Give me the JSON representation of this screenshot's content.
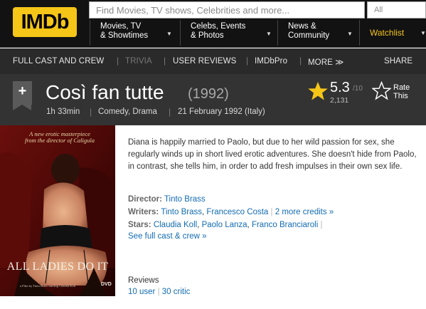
{
  "navbar": {
    "logo": "IMDb",
    "search_placeholder": "Find Movies, TV shows, Celebrities and more...",
    "search_category": "All",
    "menus": [
      {
        "label": "Movies, TV\n& Showtimes"
      },
      {
        "label": "Celebs, Events\n& Photos"
      },
      {
        "label": "News &\nCommunity"
      }
    ],
    "watchlist": "Watchlist",
    "colors": {
      "brand": "#f5c518",
      "background": "#121212"
    }
  },
  "subnav": {
    "items": [
      {
        "label": "FULL CAST AND CREW"
      },
      {
        "label": "TRIVIA"
      },
      {
        "label": "USER REVIEWS"
      },
      {
        "label": "IMDbPro"
      },
      {
        "label": "MORE ≫"
      }
    ],
    "share": "SHARE"
  },
  "title": {
    "add_symbol": "+",
    "name": "Così fan tutte",
    "year": "(1992)",
    "runtime": "1h 33min",
    "genres": "Comedy, Drama",
    "release": "21 February 1992 (Italy)",
    "rating": "5.3",
    "rating_max": "/10",
    "rating_count": "2,131",
    "rate_label": "Rate\nThis"
  },
  "poster": {
    "tagline": "A new erotic masterpiece\nfrom the director of Caligula",
    "title": "ALL LADIES DO IT",
    "credit": "a Film by Tinto Brass    starring Claudia Koll",
    "badge": "DVD"
  },
  "main": {
    "summary": "Diana is happily married to Paolo, but due to her wild passion for sex, she regularly winds up in short lived erotic adventures. She doesn't hide from Paolo, in contrast, she tells him, in order to add fresh impulses in their own sex life.",
    "director_label": "Director:",
    "director": "Tinto Brass",
    "writers_label": "Writers:",
    "writers": [
      "Tinto Brass",
      "Francesco Costa"
    ],
    "more_credits": "2 more credits »",
    "stars_label": "Stars:",
    "stars": [
      "Claudia Koll",
      "Paolo Lanza",
      "Franco Branciaroli"
    ],
    "full_cast": "See full cast & crew »",
    "reviews_label": "Reviews",
    "user_reviews": "10 user",
    "critic_reviews": "30 critic"
  }
}
